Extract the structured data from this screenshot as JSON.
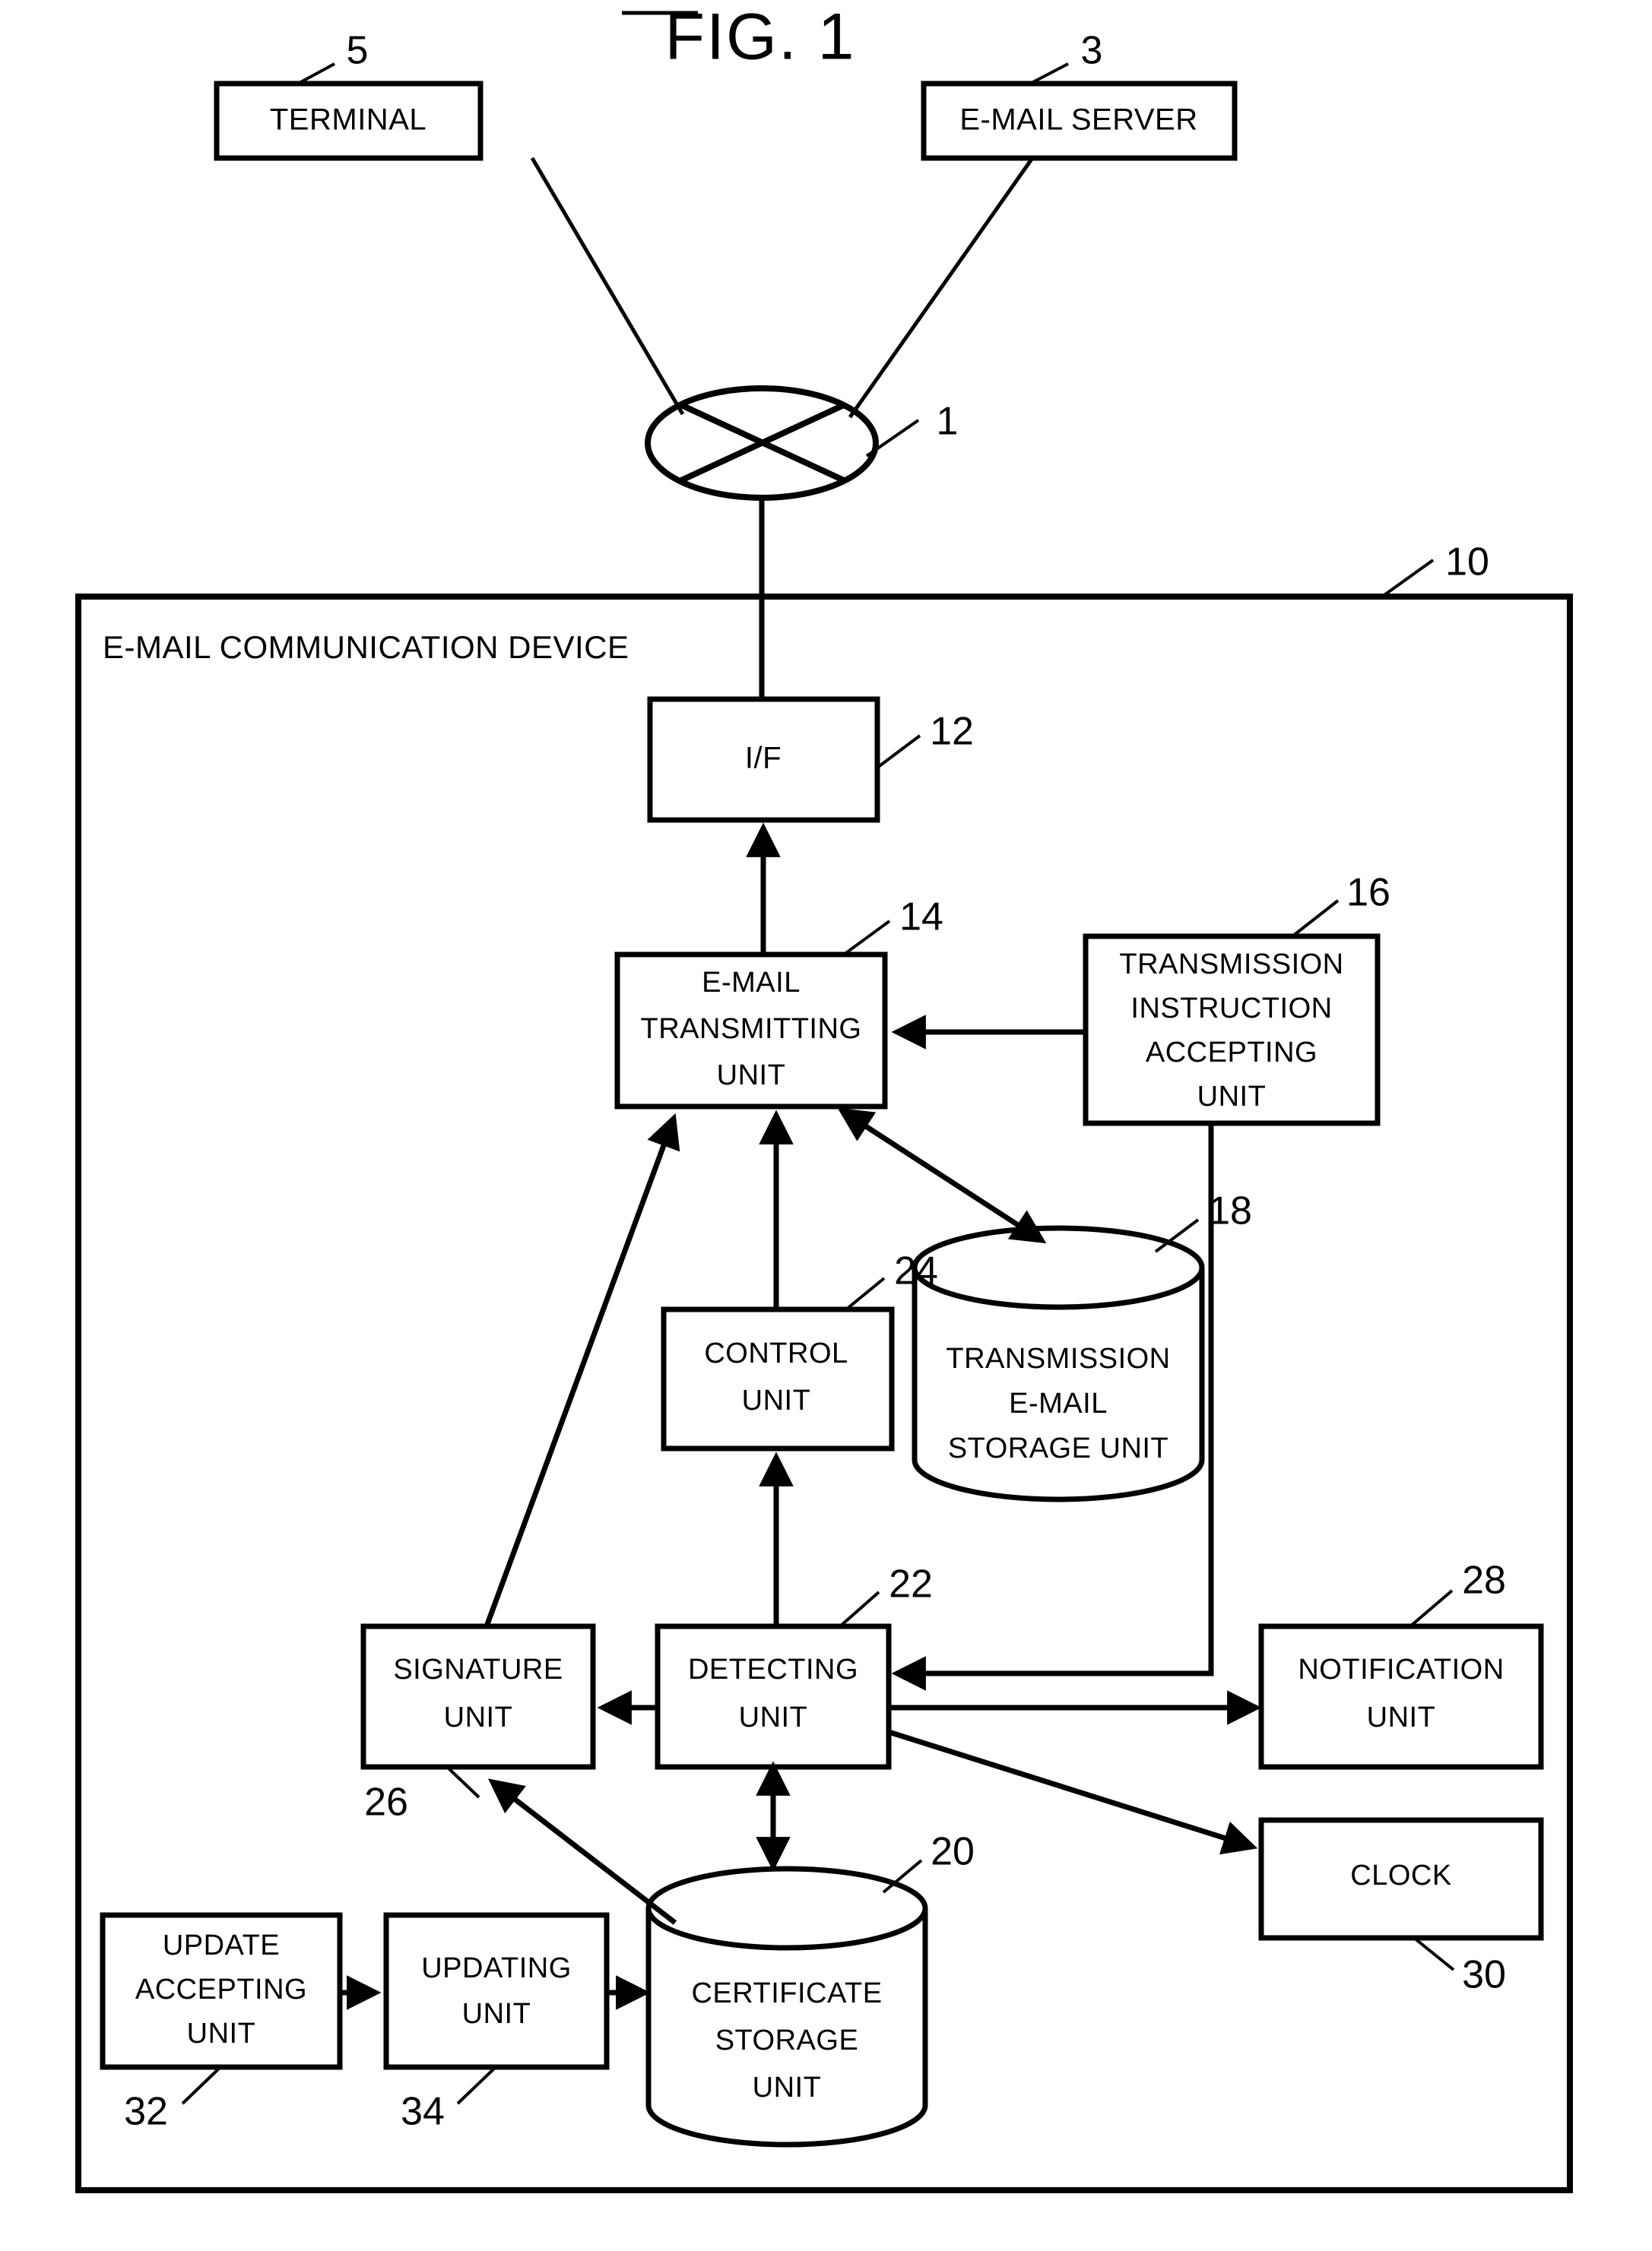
{
  "figure": {
    "title": "FIG. 1",
    "device_frame_label": "E-MAIL COMMUNICATION DEVICE",
    "device_frame_ref": "10"
  },
  "nodes": {
    "terminal": {
      "label": "TERMINAL",
      "ref": "5"
    },
    "email_server": {
      "label": "E-MAIL SERVER",
      "ref": "3"
    },
    "network": {
      "label": "",
      "ref": "1"
    },
    "interface": {
      "label": "I/F",
      "ref": "12"
    },
    "email_transmitting_unit": {
      "line1": "E-MAIL",
      "line2": "TRANSMITTING",
      "line3": "UNIT",
      "ref": "14"
    },
    "transmission_instruction_accepting_unit": {
      "line1": "TRANSMISSION",
      "line2": "INSTRUCTION",
      "line3": "ACCEPTING",
      "line4": "UNIT",
      "ref": "16"
    },
    "transmission_email_storage_unit": {
      "line1": "TRANSMISSION",
      "line2": "E-MAIL",
      "line3": "STORAGE UNIT",
      "ref": "18"
    },
    "control_unit": {
      "line1": "CONTROL",
      "line2": "UNIT",
      "ref": "24"
    },
    "signature_unit": {
      "line1": "SIGNATURE",
      "line2": "UNIT",
      "ref": "26"
    },
    "detecting_unit": {
      "line1": "DETECTING",
      "line2": "UNIT",
      "ref": "22"
    },
    "notification_unit": {
      "line1": "NOTIFICATION",
      "line2": "UNIT",
      "ref": "28"
    },
    "clock": {
      "label": "CLOCK",
      "ref": "30"
    },
    "certificate_storage_unit": {
      "line1": "CERTIFICATE",
      "line2": "STORAGE",
      "line3": "UNIT",
      "ref": "20"
    },
    "update_accepting_unit": {
      "line1": "UPDATE",
      "line2": "ACCEPTING",
      "line3": "UNIT",
      "ref": "32"
    },
    "updating_unit": {
      "line1": "UPDATING",
      "line2": "UNIT",
      "ref": "34"
    }
  },
  "colors": {
    "ink": "#000000",
    "paper": "#ffffff"
  }
}
